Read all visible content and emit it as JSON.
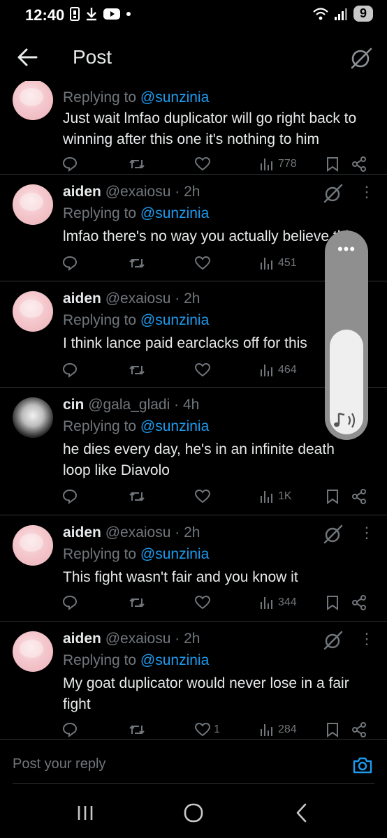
{
  "status_bar": {
    "time": "12:40",
    "battery": "9"
  },
  "header": {
    "title": "Post"
  },
  "replying_prefix": "Replying to",
  "posts": [
    {
      "name": "",
      "handle": "",
      "time": "",
      "mention": "@sunzinia",
      "text": "Just wait lmfao duplicator will go right back to winning after this one it's nothing to him",
      "views": "778",
      "likes": ""
    },
    {
      "name": "aiden",
      "handle": "@exaiosu",
      "time": "2h",
      "mention": "@sunzinia",
      "text": "lmfao there's no way you actually believe this",
      "views": "451",
      "likes": ""
    },
    {
      "name": "aiden",
      "handle": "@exaiosu",
      "time": "2h",
      "mention": "@sunzinia",
      "text": "I think lance paid earclacks off for this",
      "views": "464",
      "likes": ""
    },
    {
      "name": "cin",
      "handle": "@gala_gladi",
      "time": "4h",
      "mention": "@sunzinia",
      "text": "he dies every day, he's in an infinite death loop like Diavolo",
      "views": "1K",
      "likes": ""
    },
    {
      "name": "aiden",
      "handle": "@exaiosu",
      "time": "2h",
      "mention": "@sunzinia",
      "text": "This fight wasn't fair and you know it",
      "views": "344",
      "likes": ""
    },
    {
      "name": "aiden",
      "handle": "@exaiosu",
      "time": "2h",
      "mention": "@sunzinia",
      "text": "My goat duplicator would never lose in a fair fight",
      "views": "284",
      "likes": "1"
    }
  ],
  "reply_bar": {
    "placeholder": "Post your reply"
  },
  "volume": {
    "level": 0.5,
    "menu_icon": "more-dots-icon",
    "icon": "media-volume-icon"
  },
  "colors": {
    "accent": "#1d9bf0",
    "muted": "#71767b",
    "text": "#e7e9ea",
    "background": "#000000"
  }
}
